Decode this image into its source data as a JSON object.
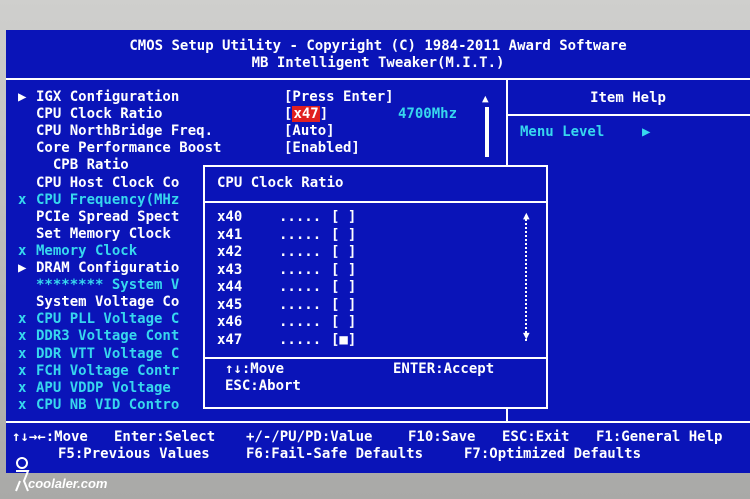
{
  "header": {
    "line1": "CMOS Setup Utility - Copyright (C) 1984-2011 Award Software",
    "line2": "MB Intelligent Tweaker(M.I.T.)"
  },
  "menu_items": [
    {
      "marker": "▶",
      "label": "IGX Configuration",
      "value": "[Press Enter]",
      "style": "white"
    },
    {
      "marker": "",
      "label": "CPU Clock Ratio",
      "value": "[x47]",
      "style": "white"
    },
    {
      "marker": "",
      "label": "CPU NorthBridge Freq.",
      "value": "[Auto]",
      "style": "white"
    },
    {
      "marker": "",
      "label": "Core Performance Boost",
      "value": "[Enabled]",
      "style": "white"
    },
    {
      "marker": "",
      "label": "  CPB Ratio",
      "value": "",
      "style": "white"
    },
    {
      "marker": "",
      "label": "CPU Host Clock Co",
      "value": "",
      "style": "white"
    },
    {
      "marker": "x",
      "label": "CPU Frequency(MHz",
      "value": "",
      "style": "cyan"
    },
    {
      "marker": "",
      "label": "PCIe Spread Spect",
      "value": "",
      "style": "white"
    },
    {
      "marker": "",
      "label": "Set Memory Clock",
      "value": "",
      "style": "white"
    },
    {
      "marker": "x",
      "label": "Memory Clock",
      "value": "",
      "style": "cyan"
    },
    {
      "marker": "▶",
      "label": "DRAM Configuratio",
      "value": "",
      "style": "white"
    },
    {
      "marker": "",
      "label": "******** System V",
      "value": "",
      "style": "cyan"
    },
    {
      "marker": "",
      "label": "System Voltage Co",
      "value": "",
      "style": "white"
    },
    {
      "marker": "x",
      "label": "CPU PLL Voltage C",
      "value": "",
      "style": "cyan"
    },
    {
      "marker": "x",
      "label": "DDR3 Voltage Cont",
      "value": "",
      "style": "cyan"
    },
    {
      "marker": "x",
      "label": "DDR VTT Voltage C",
      "value": "",
      "style": "cyan"
    },
    {
      "marker": "x",
      "label": "FCH Voltage Contr",
      "value": "",
      "style": "cyan"
    },
    {
      "marker": "x",
      "label": "APU VDDP Voltage",
      "value": "",
      "style": "cyan"
    },
    {
      "marker": "x",
      "label": "CPU NB VID Contro",
      "value": "",
      "style": "cyan"
    }
  ],
  "cpu_freq_readout": "4700Mhz",
  "item_help": {
    "title": "Item Help",
    "menu_level": "Menu Level",
    "menu_level_marker": "▶"
  },
  "popup": {
    "title": "CPU Clock Ratio",
    "options": [
      {
        "label": "x40",
        "dots": ".....",
        "box": "[ ]"
      },
      {
        "label": "x41",
        "dots": ".....",
        "box": "[ ]"
      },
      {
        "label": "x42",
        "dots": ".....",
        "box": "[ ]"
      },
      {
        "label": "x43",
        "dots": ".....",
        "box": "[ ]"
      },
      {
        "label": "x44",
        "dots": ".....",
        "box": "[ ]"
      },
      {
        "label": "x45",
        "dots": ".....",
        "box": "[ ]"
      },
      {
        "label": "x46",
        "dots": ".....",
        "box": "[ ]"
      },
      {
        "label": "x47",
        "dots": ".....",
        "box": "[■]"
      }
    ],
    "hint_move": "↑↓:Move",
    "hint_accept": "ENTER:Accept",
    "hint_abort": "ESC:Abort"
  },
  "footer": {
    "line1": [
      "↑↓→←:Move",
      "Enter:Select",
      "+/-/PU/PD:Value",
      "F10:Save",
      "ESC:Exit",
      "F1:General Help"
    ],
    "line2": [
      "F5:Previous Values",
      "F6:Fail-Safe Defaults",
      "F7:Optimized Defaults"
    ]
  },
  "watermark": "coolaler.com",
  "colors": {
    "background": "#0a14b8",
    "highlight": "#e02020",
    "disabled": "#37d7ee",
    "text": "#ffffff"
  }
}
